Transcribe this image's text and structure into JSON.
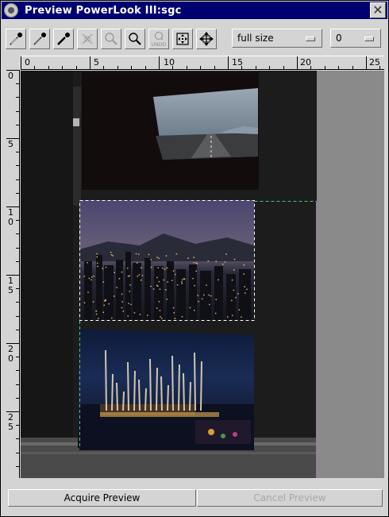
{
  "window": {
    "title": "Preview PowerLook III:sgc",
    "close_glyph": "✕"
  },
  "toolbar": {
    "tools": [
      {
        "name": "eyedropper-white-icon"
      },
      {
        "name": "eyedropper-gray-icon"
      },
      {
        "name": "eyedropper-black-icon"
      },
      {
        "name": "crop-disabled-icon"
      },
      {
        "name": "zoom-out-disabled-icon"
      },
      {
        "name": "zoom-in-icon"
      },
      {
        "name": "undo-zoom-icon",
        "label": "UNDO"
      },
      {
        "name": "fit-frame-icon"
      },
      {
        "name": "move-frame-icon"
      }
    ],
    "zoom_select": {
      "value": "full size"
    },
    "frame_select": {
      "value": "0"
    }
  },
  "ruler": {
    "horizontal_labels": [
      "0",
      "5",
      "10",
      "15",
      "20",
      "25"
    ],
    "vertical_labels": [
      [
        "0"
      ],
      [
        "5"
      ],
      [
        "1",
        "0"
      ],
      [
        "1",
        "5"
      ],
      [
        "2",
        "0"
      ],
      [
        "2",
        "5"
      ]
    ]
  },
  "colors": {
    "title_bar": "#000070",
    "canvas_bg": "#8a8a8a",
    "selection_dashed": "#ffffff",
    "frame_guide_green": "#3ad07a",
    "frame_guide_purple": "#a070c0"
  },
  "buttons": {
    "acquire_preview": "Acquire Preview",
    "cancel_preview": "Cancel Preview"
  }
}
